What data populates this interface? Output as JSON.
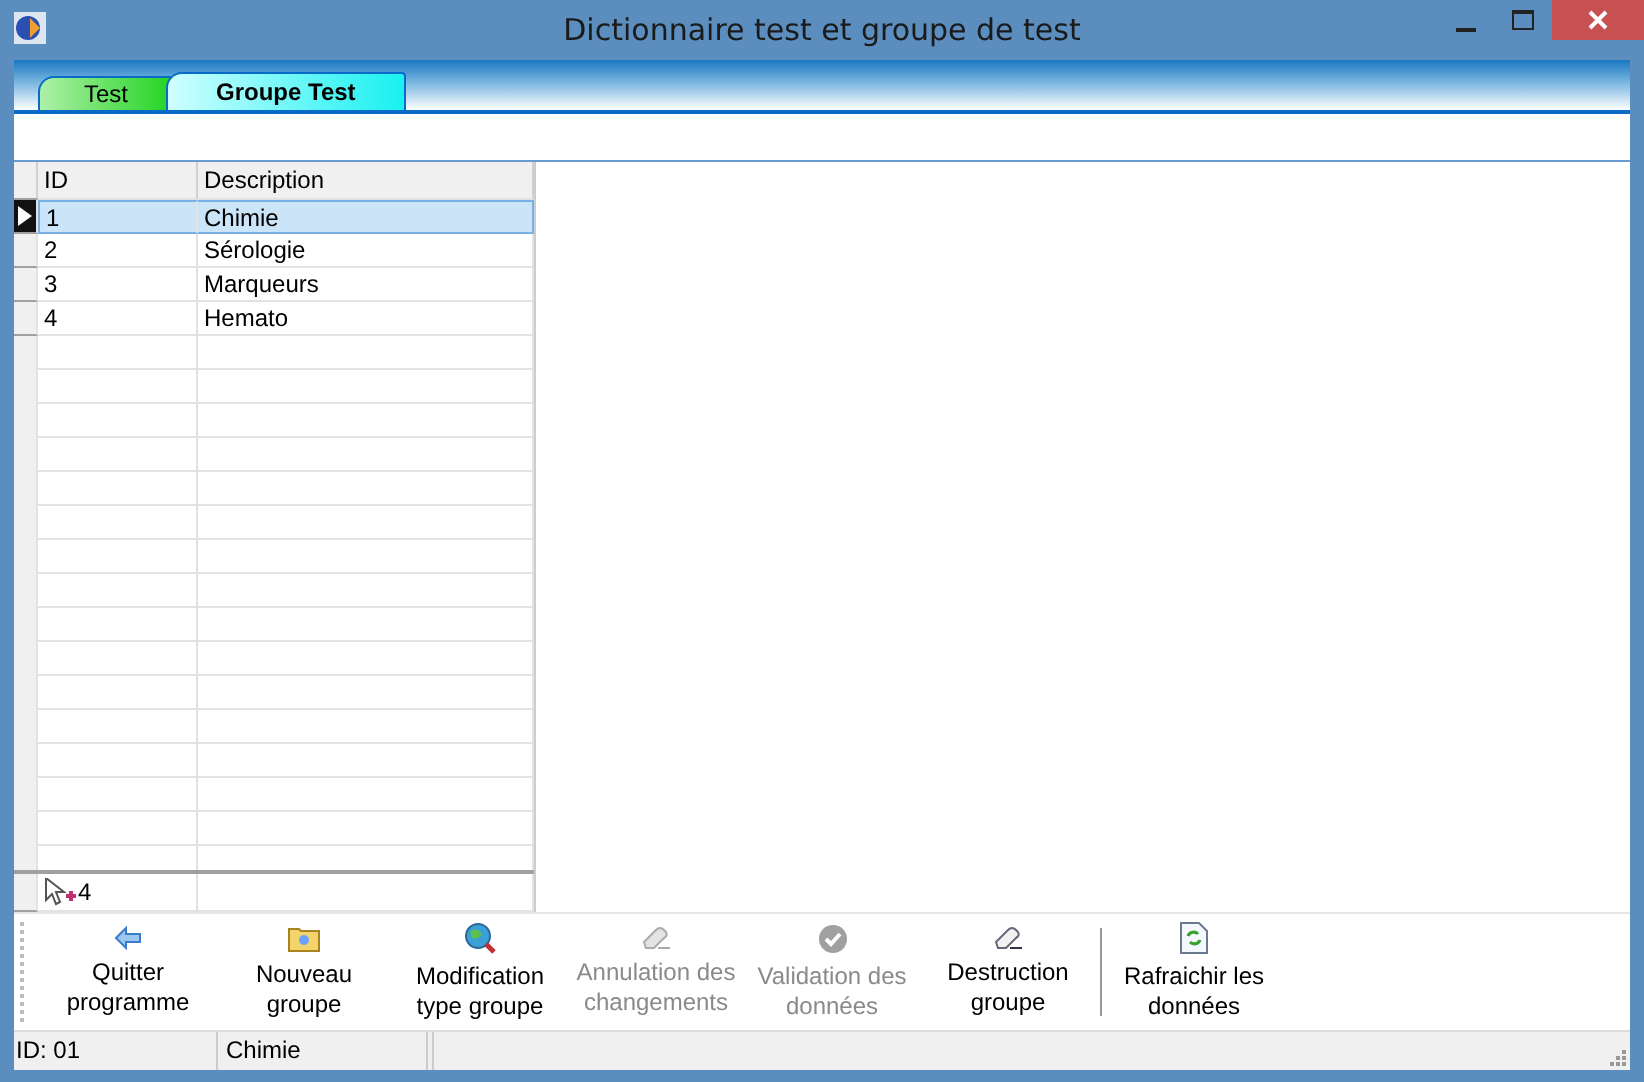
{
  "window": {
    "title": "Dictionnaire test et groupe de test"
  },
  "tabs": [
    {
      "label": "Test",
      "selected": false
    },
    {
      "label": "Groupe Test",
      "selected": true
    }
  ],
  "grid": {
    "columns": [
      "ID",
      "Description"
    ],
    "rows": [
      {
        "id": "1",
        "description": "Chimie",
        "selected": true
      },
      {
        "id": "2",
        "description": "Sérologie",
        "selected": false
      },
      {
        "id": "3",
        "description": "Marqueurs",
        "selected": false
      },
      {
        "id": "4",
        "description": "Hemato",
        "selected": false
      }
    ],
    "record_count": "4"
  },
  "toolbar": [
    {
      "label": "Quitter programme",
      "disabled": false,
      "separated": false
    },
    {
      "label": "Nouveau groupe",
      "disabled": false,
      "separated": false
    },
    {
      "label": "Modification type groupe",
      "disabled": false,
      "separated": false
    },
    {
      "label": "Annulation des changements",
      "disabled": true,
      "separated": false
    },
    {
      "label": "Validation des données",
      "disabled": true,
      "separated": false
    },
    {
      "label": "Destruction groupe",
      "disabled": false,
      "separated": false
    },
    {
      "label": "Rafraichir les données",
      "disabled": false,
      "separated": true
    }
  ],
  "status_bar": [
    "ID: 01",
    "Chimie"
  ]
}
